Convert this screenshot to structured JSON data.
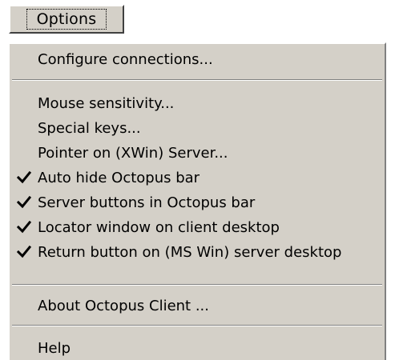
{
  "menu": {
    "title": "Options"
  },
  "items": [
    {
      "label": "Configure connections...",
      "checked": false
    },
    {
      "label": "Mouse sensitivity...",
      "checked": false
    },
    {
      "label": "Special  keys...",
      "checked": false
    },
    {
      "label": "Pointer on (XWin)  Server...",
      "checked": false
    },
    {
      "label": "Auto hide Octopus bar",
      "checked": true
    },
    {
      "label": "Server buttons in Octopus bar",
      "checked": true
    },
    {
      "label": "Locator window on client desktop",
      "checked": true
    },
    {
      "label": "Return button on (MS Win) server desktop",
      "checked": true
    },
    {
      "label": "About Octopus Client ...",
      "checked": false
    },
    {
      "label": "Help",
      "checked": false
    }
  ],
  "icons": {
    "check": "checkmark-icon"
  },
  "colors": {
    "menu_bg": "#d4d0c8",
    "text": "#000000"
  }
}
